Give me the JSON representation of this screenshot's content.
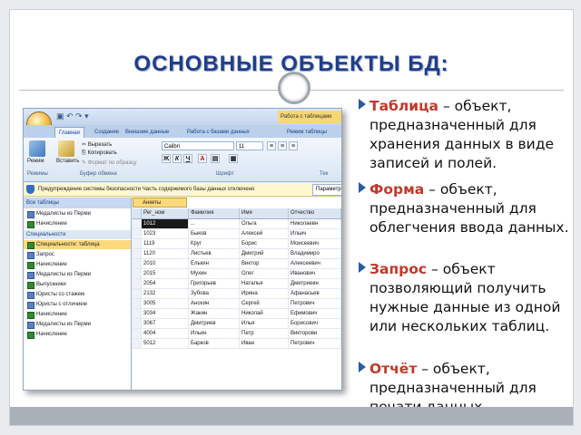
{
  "slide": {
    "title": "ОСНОВНЫЕ ОБЪЕКТЫ БД:"
  },
  "bullets": [
    {
      "term": "Таблица",
      "rest": " – объект, предназначенный для хранения данных в виде записей и полей."
    },
    {
      "term": "Форма",
      "rest": " – объект, предназначенный для облегчения ввода данных."
    },
    {
      "term": "Запрос",
      "rest": " – объект позволяющий получить нужные данные из одной или нескольких таблиц."
    },
    {
      "term": "Отчёт",
      "rest": " – объект, предназначенный для печати данных."
    }
  ],
  "access": {
    "context_tab": "Работа с таблицами",
    "tabs": [
      "Главная",
      "Создание",
      "Внешние данные",
      "Работа с базами данных",
      "Режим таблицы"
    ],
    "ribbon": {
      "view_label": "Режим",
      "paste_label": "Вставить",
      "cut_label": "Вырезать",
      "copy_label": "Копировать",
      "format_label": "Формат по образцу",
      "font_value": "Calibri",
      "size_value": "11",
      "bold": "Ж",
      "italic": "К",
      "underline": "Ч",
      "group_views": "Режимы",
      "group_clipboard": "Буфер обмена",
      "group_font": "Шрифт",
      "group_rich": "Тек"
    },
    "security_text": "Предупреждение системы безопасности   Часть содержимого базы данных отключено",
    "params_label": "Параметры...",
    "nav": {
      "header": "Все таблицы",
      "rows_top": [
        {
          "label": "Медалисты из Перми",
          "type": "q"
        },
        {
          "label": "Начисление",
          "type": "t"
        }
      ],
      "section": "Специальности",
      "rows": [
        {
          "label": "Специальности: таблица",
          "type": "t",
          "selected": true
        },
        {
          "label": "Запрос",
          "type": "q"
        },
        {
          "label": "Начисление",
          "type": "t"
        },
        {
          "label": "Медалисты из Перми",
          "type": "q"
        },
        {
          "label": "Выпускники",
          "type": "t"
        },
        {
          "label": "Юристы со стажем",
          "type": "q"
        },
        {
          "label": "Юристы с отличием",
          "type": "q"
        },
        {
          "label": "Начисление",
          "type": "t"
        },
        {
          "label": "Медалисты из Перми",
          "type": "q"
        },
        {
          "label": "Начисление",
          "type": "t"
        }
      ]
    },
    "grid": {
      "tab_label": "Анкеты",
      "headers": [
        "Рег_ном",
        "Фамилия",
        "Имя",
        "Отчество"
      ],
      "rows": [
        [
          "1012",
          "...",
          "Ольга",
          "Николаевн"
        ],
        [
          "1023",
          "Быков",
          "Алексей",
          "Ильич"
        ],
        [
          "1119",
          "Круг",
          "Борис",
          "Моисеевич"
        ],
        [
          "1120",
          "Листьев",
          "Дмитрий",
          "Владимиро"
        ],
        [
          "2010",
          "Елькин",
          "Виктор",
          "Алексеевич"
        ],
        [
          "2015",
          "Мухин",
          "Олег",
          "Иванович"
        ],
        [
          "2054",
          "Григорьев",
          "Наталья",
          "Дмитриевн"
        ],
        [
          "2132",
          "Зубова",
          "Ирина",
          "Афанасьев"
        ],
        [
          "3005",
          "Анохин",
          "Сергей",
          "Петрович"
        ],
        [
          "3034",
          "Жакин",
          "Николай",
          "Ефимович"
        ],
        [
          "3067",
          "Дмитриев",
          "Илья",
          "Борисович"
        ],
        [
          "4004",
          "Ильин",
          "Петр",
          "Викторови"
        ],
        [
          "5012",
          "Барков",
          "Иван",
          "Петрович"
        ]
      ]
    }
  }
}
